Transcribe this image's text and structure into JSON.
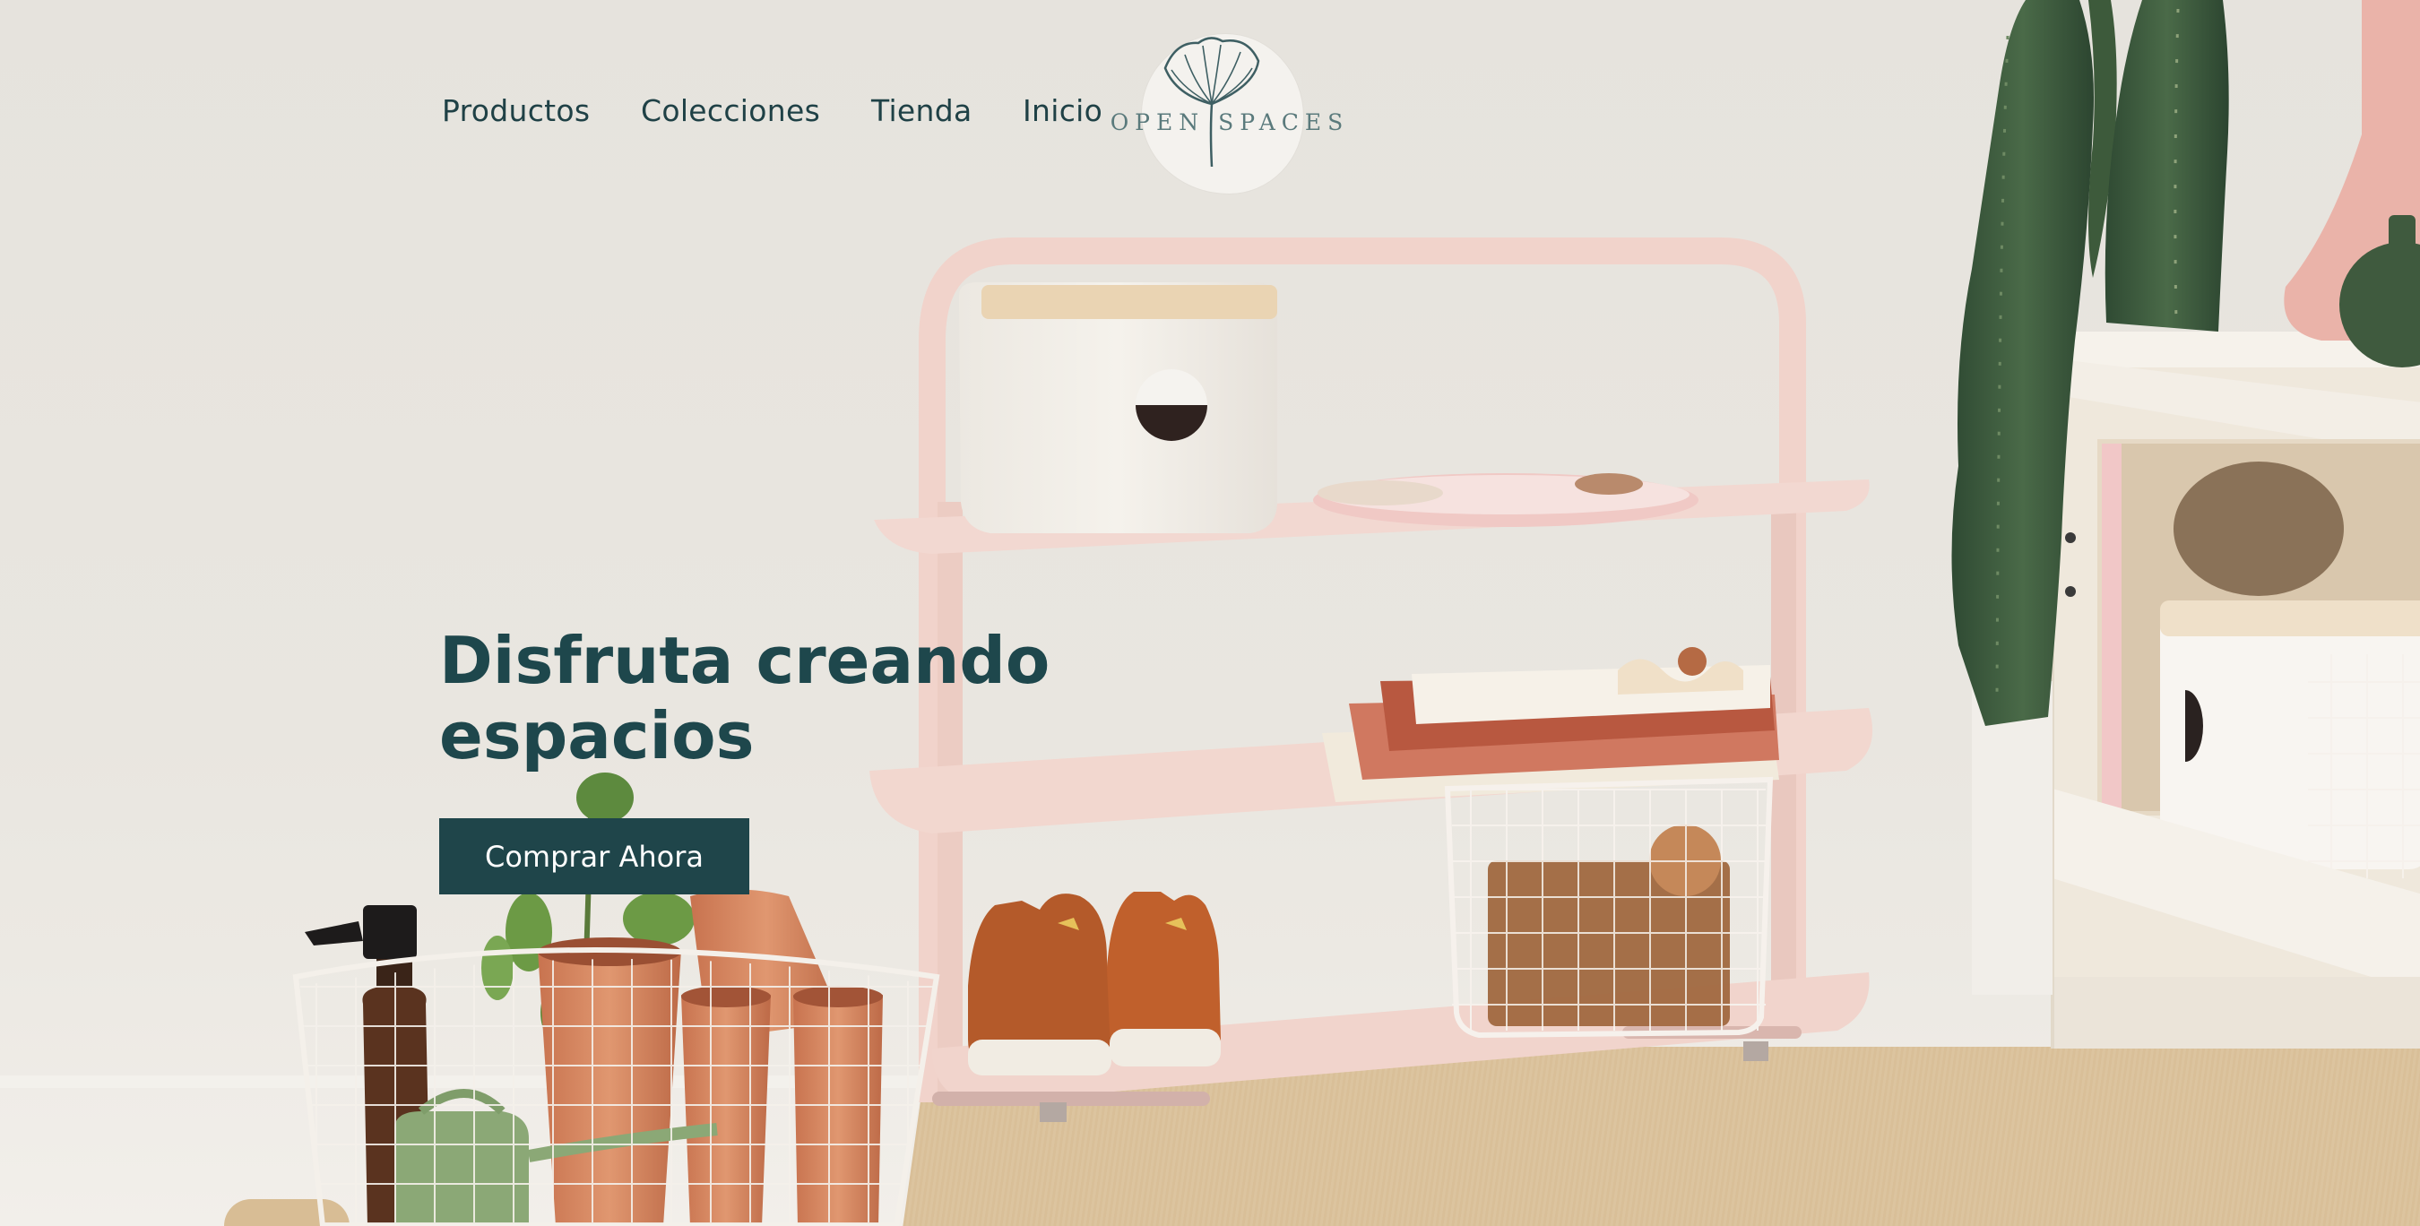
{
  "nav": {
    "links": [
      "Productos",
      "Colecciones",
      "Tienda",
      "Inicio"
    ]
  },
  "logo": {
    "text": "OPEN SPACES"
  },
  "hero": {
    "title": "Disfruta creando espacios",
    "cta_label": "Comprar Ahora"
  },
  "colors": {
    "primary": "#1f454a",
    "text_dark": "#1f4146",
    "background": "#e7e4de",
    "shelf_pink": "#f0d4cd"
  }
}
